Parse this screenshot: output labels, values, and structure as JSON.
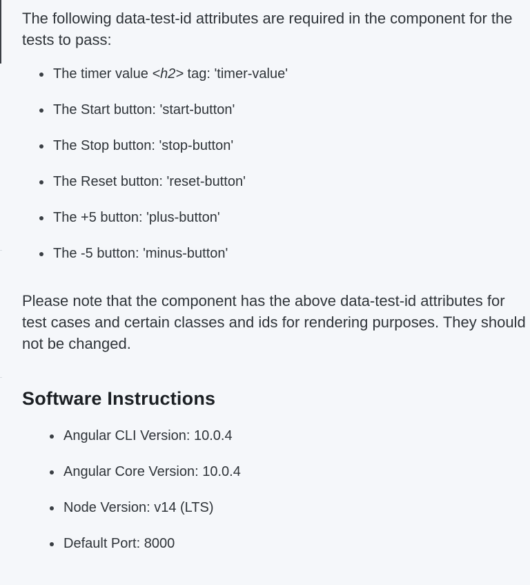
{
  "intro": "The following data-test-id attributes are required in the component for the tests to pass:",
  "test_ids": [
    {
      "prefix": "The timer value ",
      "tag": "<h2>",
      "suffix": " tag: 'timer-value'"
    },
    {
      "text": "The Start button: 'start-button'"
    },
    {
      "text": "The Stop button: 'stop-button'"
    },
    {
      "text": "The Reset button: 'reset-button'"
    },
    {
      "text": "The +5 button: 'plus-button'"
    },
    {
      "text": "The -5 button: 'minus-button'"
    }
  ],
  "note": "Please note that the component has the above data-test-id attributes for test cases and certain classes and ids for rendering purposes. They should not be changed.",
  "software": {
    "title": "Software Instructions",
    "items": [
      "Angular CLI Version: 10.0.4",
      "Angular Core Version: 10.0.4",
      "Node Version: v14 (LTS)",
      "Default Port: 8000"
    ]
  }
}
